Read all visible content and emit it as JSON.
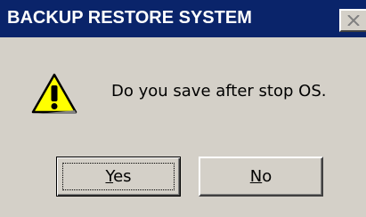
{
  "window": {
    "title": "BACKUP RESTORE SYSTEM"
  },
  "dialog": {
    "icon": "warning-icon",
    "message": "Do you save after stop OS."
  },
  "buttons": {
    "yes": {
      "label_mnemonic": "Y",
      "label_rest": "es"
    },
    "no": {
      "label_mnemonic": "N",
      "label_rest": "o"
    }
  },
  "colors": {
    "titlebar": "#0a246a",
    "face": "#d4d0c8",
    "warning_fill": "#ffff00"
  }
}
